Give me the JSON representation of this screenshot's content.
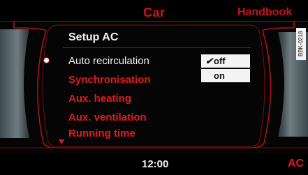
{
  "header": {
    "tabs": [
      {
        "label": "Car",
        "active": true
      },
      {
        "label": "Handbook",
        "active": false
      }
    ]
  },
  "corner_code": "BBK-0218",
  "menu": {
    "title": "Setup AC",
    "items": [
      {
        "label": "Auto recirculation",
        "selected": true
      },
      {
        "label": "Synchronisation",
        "selected": false
      },
      {
        "label": "Aux. heating",
        "selected": false
      },
      {
        "label": "Aux. ventilation",
        "selected": false
      },
      {
        "label": "Running time",
        "selected": false
      }
    ]
  },
  "options": {
    "values": [
      {
        "label": "off",
        "checked": true
      },
      {
        "label": "on",
        "checked": false
      }
    ],
    "check_mark": "✔"
  },
  "footer": {
    "time": "12:00",
    "right_label": "AC"
  },
  "colors": {
    "accent_red": "#e01b24",
    "background": "#050505",
    "text_white": "#f4f4f4"
  }
}
